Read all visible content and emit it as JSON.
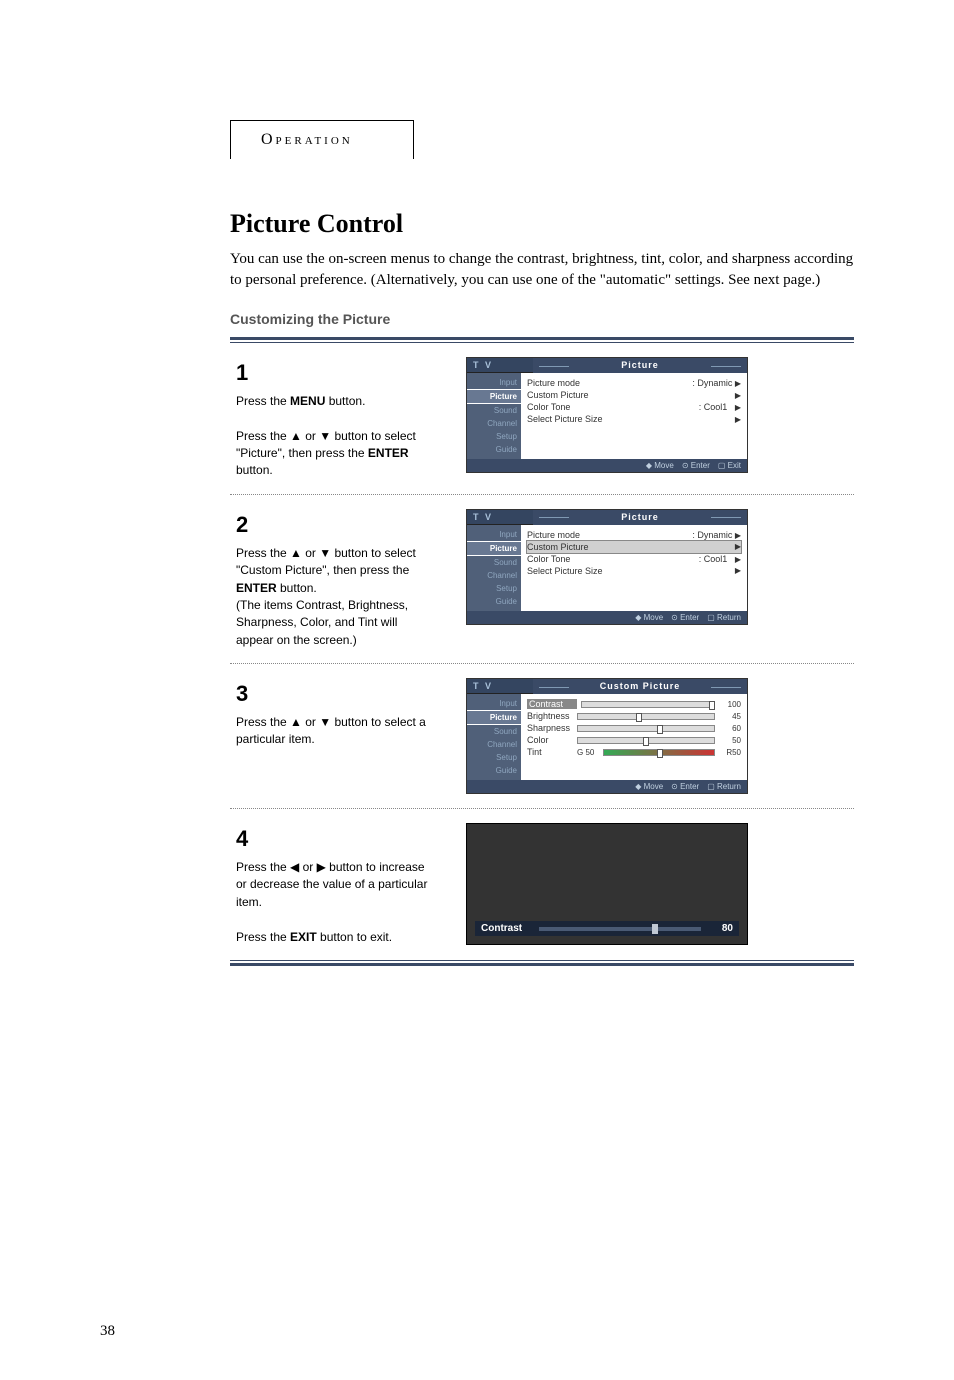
{
  "header_tab": "Operation",
  "title": "Picture Control",
  "intro": "You can use the on-screen menus to change the contrast, brightness, tint, color, and sharpness according to personal preference. (Alternatively, you can use one of the \"automatic\" settings. See next page.)",
  "subhead": "Customizing the Picture",
  "page_number": "38",
  "steps": {
    "s1": {
      "num": "1",
      "p1a": "Press the ",
      "p1b": "MENU",
      "p1c": " button.",
      "p2a": "Press the ▲ or ▼ button to select \"Picture\", then press the ",
      "p2b": "ENTER",
      "p2c": " button."
    },
    "s2": {
      "num": "2",
      "p1a": "Press the ▲ or ▼ button to select \"Custom Picture\", then press the ",
      "p1b": "ENTER",
      "p1c": " button.",
      "p2": "(The items Contrast, Brightness, Sharpness, Color, and Tint will appear on the screen.)"
    },
    "s3": {
      "num": "3",
      "p1": "Press the ▲ or ▼ button to select a particular item."
    },
    "s4": {
      "num": "4",
      "p1": "Press the ◀ or ▶ button to increase or decrease the value of a particular item.",
      "p2a": "Press the ",
      "p2b": "EXIT",
      "p2c": " button to exit."
    }
  },
  "osd": {
    "tv": "T V",
    "title_picture": "Picture",
    "title_custom": "Custom Picture",
    "nav": {
      "input": "Input",
      "picture": "Picture",
      "sound": "Sound",
      "channel": "Channel",
      "setup": "Setup",
      "guide": "Guide"
    },
    "rows": {
      "picture_mode": "Picture mode",
      "picture_mode_val": ": Dynamic",
      "custom_picture": "Custom Picture",
      "color_tone": "Color Tone",
      "color_tone_val": ": Cool1",
      "select_size": "Select Picture Size"
    },
    "footer": {
      "move": "Move",
      "enter": "Enter",
      "exit": "Exit",
      "return": "Return"
    },
    "custom": {
      "contrast": "Contrast",
      "contrast_val": "100",
      "brightness": "Brightness",
      "brightness_val": "45",
      "sharpness": "Sharpness",
      "sharpness_val": "60",
      "color": "Color",
      "color_val": "50",
      "tint": "Tint",
      "tint_pre": "G 50",
      "tint_val": "R50"
    },
    "preview": {
      "label": "Contrast",
      "value": "80"
    }
  }
}
